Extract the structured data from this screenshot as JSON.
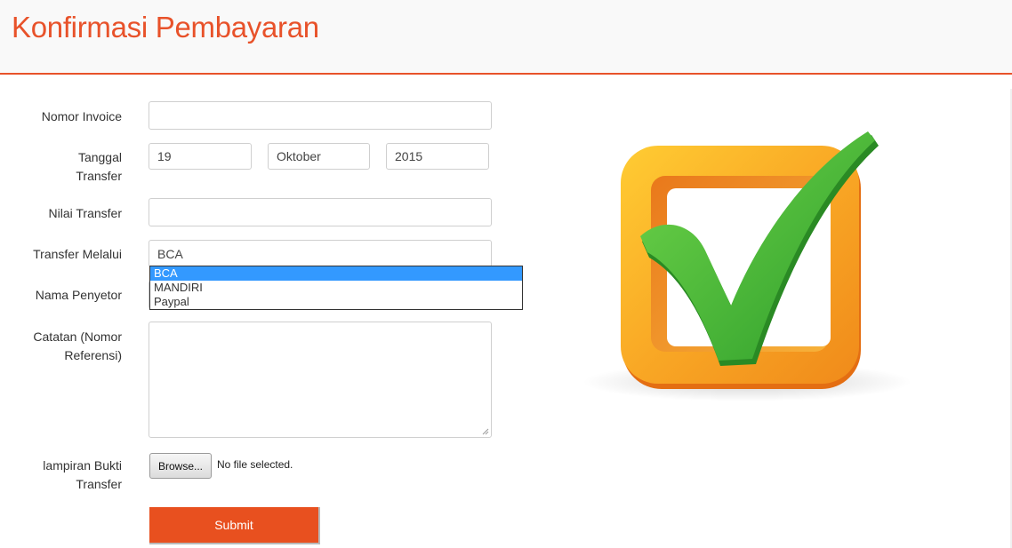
{
  "page": {
    "title": "Konfirmasi Pembayaran"
  },
  "form": {
    "invoice": {
      "label": "Nomor Invoice",
      "value": ""
    },
    "date": {
      "label_line1": "Tanggal",
      "label_line2": "Transfer",
      "day": "19",
      "month": "Oktober",
      "year": "2015"
    },
    "amount": {
      "label": "Nilai Transfer",
      "value": ""
    },
    "method": {
      "label": "Transfer Melalui",
      "selected": "BCA",
      "options": [
        "BCA",
        "MANDIRI",
        "Paypal"
      ]
    },
    "depositor": {
      "label": "Nama Penyetor",
      "value": ""
    },
    "notes": {
      "label_line1": "Catatan (Nomor",
      "label_line2": "Referensi)",
      "value": ""
    },
    "attachment": {
      "label_line1": "lampiran Bukti",
      "label_line2": "Transfer",
      "browse_label": "Browse...",
      "status": "No file selected."
    },
    "submit_label": "Submit"
  },
  "colors": {
    "accent": "#e8522a",
    "submit": "#e8501f",
    "dropdown_highlight": "#3399ff"
  },
  "icons": {
    "illustration": "checkbox-checkmark-icon"
  }
}
